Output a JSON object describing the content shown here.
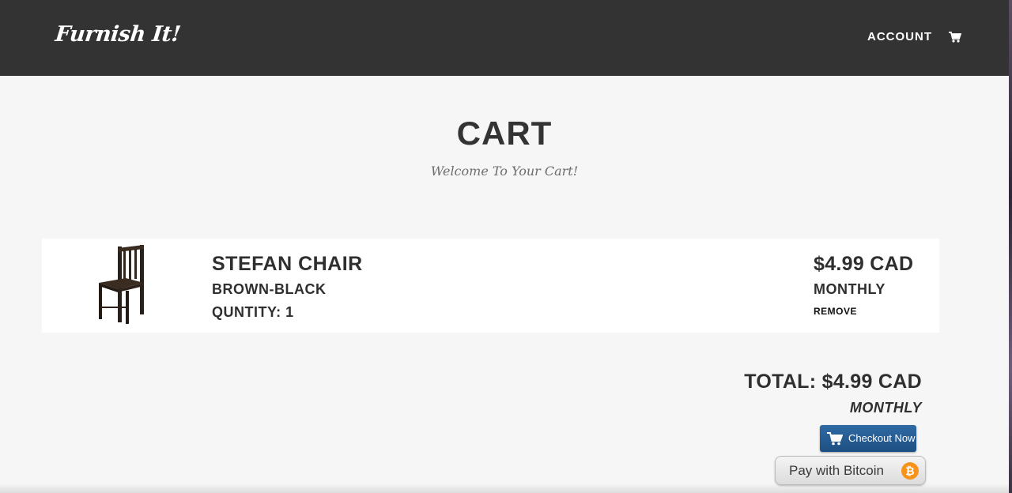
{
  "header": {
    "logo": "Furnish It!",
    "nav": {
      "account_label": "ACCOUNT",
      "cart_icon": "shopping-cart-icon"
    },
    "background": "#333333"
  },
  "hero": {
    "title": "CART",
    "subtitle": "Welcome To Your Cart!"
  },
  "cart": {
    "items": [
      {
        "image": "chair-image",
        "name": "STEFAN CHAIR",
        "variant": "BROWN-BLACK",
        "quantity_label": "QUNTITY: 1",
        "price": "$4.99 CAD",
        "frequency": "MONTHLY",
        "remove_label": "REMOVE"
      }
    ],
    "total": "TOTAL: $4.99 CAD",
    "total_frequency": "MONTHLY",
    "checkout_label": "Checkout Now",
    "bitcoin_label": "Pay with Bitcoin",
    "bitcoin_symbol": "₿"
  },
  "colors": {
    "checkout_blue": "#1e4f82",
    "bitcoin_orange": "#f7931a",
    "page_bg": "#f6f6f6"
  }
}
